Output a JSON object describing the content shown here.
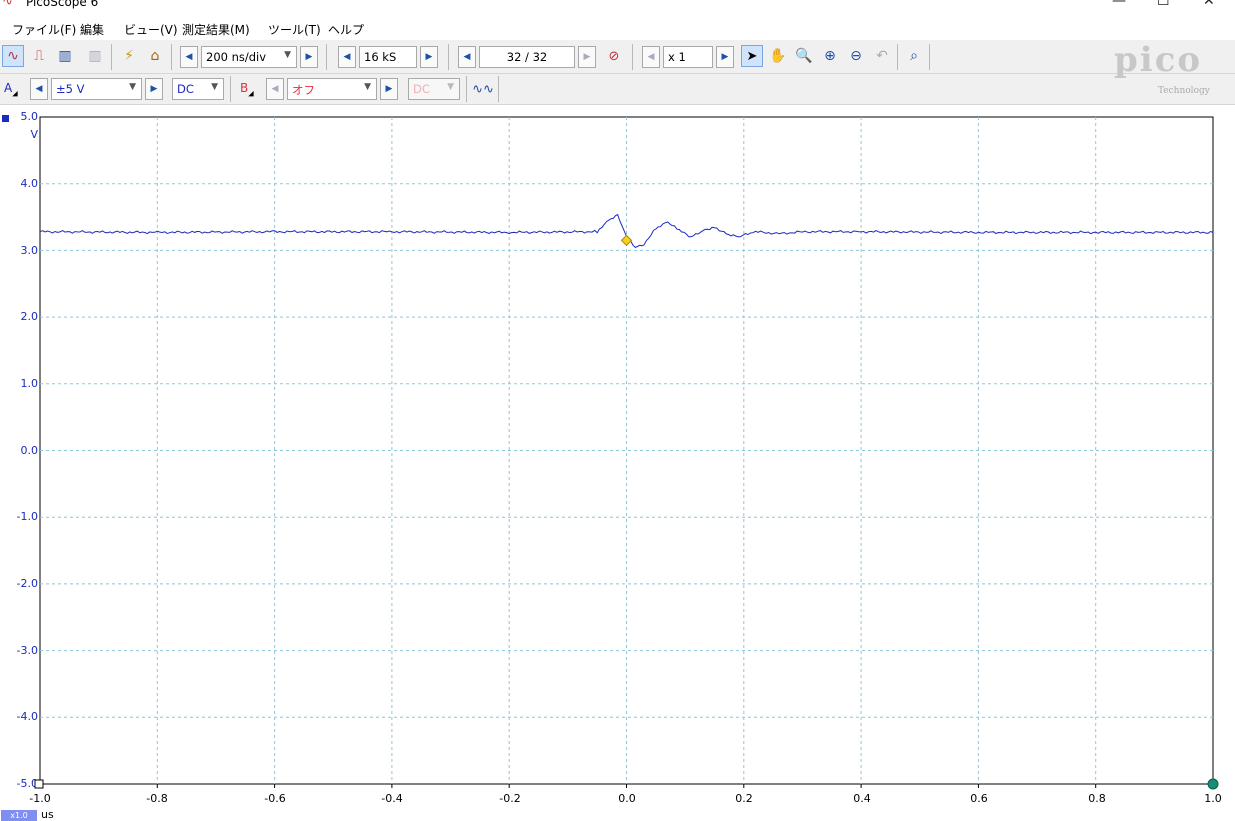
{
  "window": {
    "title": "PicoScope 6",
    "controls": {
      "minimize": "—",
      "maximize": "☐",
      "close": "✕"
    }
  },
  "menu": {
    "items": [
      "ファイル(F)",
      "編集",
      "ビュー(V)",
      "測定結果(M)",
      "ツール(T)",
      "ヘルプ"
    ]
  },
  "toolbar": {
    "timebase": "200 ns/div",
    "samples": "16 kS",
    "buffer": "32 / 32",
    "zoom": "x 1"
  },
  "channels": {
    "a": {
      "label": "A",
      "range": "±5 V",
      "coupling": "DC",
      "color": "#1a2bbd"
    },
    "b": {
      "label": "B",
      "range": "オフ",
      "coupling": "DC",
      "color": "#e0303a"
    }
  },
  "logo": {
    "text": "pico",
    "sub": "Technology"
  },
  "chart_data": {
    "type": "line",
    "y_unit": "V",
    "x_unit": "us",
    "x_ticks": [
      "-1.0",
      "-0.8",
      "-0.6",
      "-0.4",
      "-0.2",
      "0.0",
      "0.2",
      "0.4",
      "0.6",
      "0.8",
      "1.0"
    ],
    "y_ticks": [
      "5.0",
      "4.0",
      "3.0",
      "2.0",
      "1.0",
      "0.0",
      "-1.0",
      "-2.0",
      "-3.0",
      "-4.0",
      "-5.0"
    ],
    "xlim": [
      -1.0,
      1.0
    ],
    "ylim": [
      -5.0,
      5.0
    ],
    "grid": true,
    "trigger": {
      "x": 0.0,
      "y": 3.15
    },
    "zoom_badge": "x1.0",
    "series": [
      {
        "color": "#1a2bbd",
        "x": [
          -1.0,
          -0.8,
          -0.6,
          -0.4,
          -0.2,
          -0.05,
          -0.03,
          -0.015,
          0.0,
          0.015,
          0.03,
          0.05,
          0.07,
          0.09,
          0.11,
          0.13,
          0.15,
          0.17,
          0.19,
          0.22,
          0.26,
          0.3,
          0.4,
          0.6,
          0.8,
          1.0
        ],
        "y": [
          3.28,
          3.27,
          3.28,
          3.28,
          3.27,
          3.28,
          3.45,
          3.52,
          3.2,
          3.05,
          3.1,
          3.33,
          3.42,
          3.3,
          3.2,
          3.3,
          3.35,
          3.25,
          3.2,
          3.28,
          3.25,
          3.28,
          3.28,
          3.27,
          3.27,
          3.27
        ]
      }
    ]
  }
}
